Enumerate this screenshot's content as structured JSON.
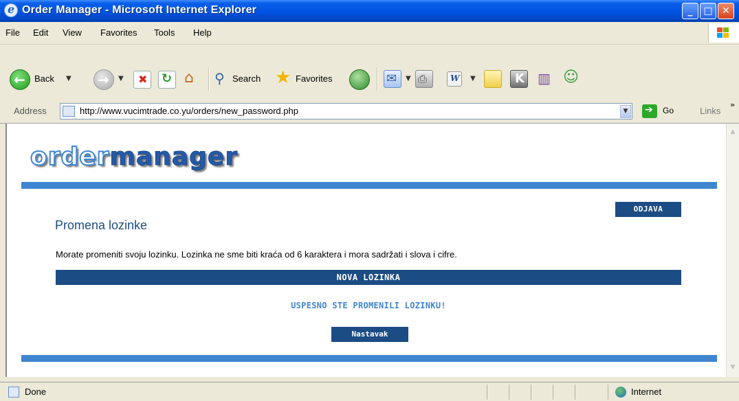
{
  "window": {
    "title": "Order Manager - Microsoft Internet Explorer"
  },
  "menu": {
    "items": [
      "File",
      "Edit",
      "View",
      "Favorites",
      "Tools",
      "Help"
    ]
  },
  "toolbar": {
    "back_label": "Back",
    "search_label": "Search",
    "favorites_label": "Favorites"
  },
  "address": {
    "label": "Address",
    "url": "http://www.vucimtrade.co.yu/orders/new_password.php",
    "go_label": "Go",
    "links_label": "Links",
    "links_more": "»"
  },
  "page": {
    "logo_part1": "order",
    "logo_part2": "manager",
    "logout_label": "ODJAVA",
    "heading": "Promena lozinke",
    "notice": "Morate promeniti svoju lozinku. Lozinka ne sme biti kraća od 6 karaktera i mora sadržati i slova i cifre.",
    "section_title": "NOVA LOZINKA",
    "success_message": "USPESNO STE PROMENILI LOZINKU!",
    "continue_label": "Nastavak"
  },
  "status": {
    "text": "Done",
    "zone": "Internet"
  },
  "colors": {
    "accent": "#3f86d0",
    "dark_blue": "#1c4c84",
    "titlebar": "#0055e5"
  }
}
